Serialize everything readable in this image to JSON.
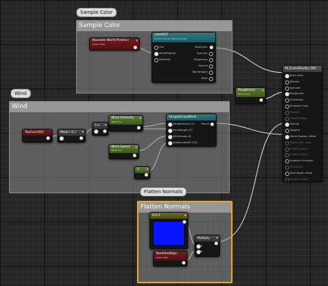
{
  "comments": {
    "sample_color": "Sample Color",
    "wind": "Wind",
    "flatten_normals": "Flatten Normals"
  },
  "nodes": {
    "absolute_world_position": {
      "title": "Absolute World Position",
      "sub": "Shader Data"
    },
    "color_rvt": {
      "title": "colorRVT",
      "sub": "Runtime Virtual Texture Sample",
      "inputs": [
        "UVs",
        "WorldPosition",
        "MipValue"
      ],
      "outputs": [
        "BaseColor",
        "Specular",
        "Roughness",
        "Normal",
        "WorldHeight",
        "Mask"
      ]
    },
    "roughness": {
      "title": "Roughness",
      "sub": "Param (0.4)"
    },
    "texcoord": {
      "title": "TexCoord[0]"
    },
    "mask_g": {
      "title": "Mask ( G )"
    },
    "one_minus": {
      "title": "1-x"
    },
    "wind_intensity": {
      "title": "Wind Intensity",
      "sub": "Param (1)"
    },
    "wind_speed": {
      "title": "Wind Speed",
      "sub": "Param (1)"
    },
    "zero_const": {
      "title": "0"
    },
    "simple_grass_wind": {
      "title": "SimpleGrassWind",
      "inputs": [
        "WindIntensity (S)",
        "WindWeight (S)",
        "WindSpeed (S)",
        "AdditionalWPO (V3)"
      ],
      "outputs": [
        "Result"
      ]
    },
    "vec_001": {
      "title": "0,0,1"
    },
    "multiply": {
      "title": "Multiply",
      "inputs": [
        "A",
        "B"
      ]
    },
    "two_sided_sign": {
      "title": "TwoSidedSign",
      "sub": "Vertex Data"
    },
    "material_result": {
      "title": "M_GrassShader_RM",
      "pins": [
        {
          "label": "Base Color",
          "active": true
        },
        {
          "label": "Metallic",
          "active": true
        },
        {
          "label": "Specular",
          "active": true
        },
        {
          "label": "Roughness",
          "active": true
        },
        {
          "label": "Anisotropy",
          "active": true
        },
        {
          "label": "Emissive Color",
          "active": true
        },
        {
          "label": "Opacity",
          "active": false
        },
        {
          "label": "Opacity Mask",
          "active": false
        },
        {
          "label": "Normal",
          "active": true
        },
        {
          "label": "Tangent",
          "active": true
        },
        {
          "label": "World Position Offset",
          "active": true
        },
        {
          "label": "Subsurface Color",
          "active": false
        },
        {
          "label": "Custom Data 0",
          "active": false
        },
        {
          "label": "Custom Data 1",
          "active": false
        },
        {
          "label": "Ambient Occlusion",
          "active": true
        },
        {
          "label": "Refraction",
          "active": false
        },
        {
          "label": "Pixel Depth Offset",
          "active": true
        },
        {
          "label": "Shading Model",
          "active": false
        }
      ]
    }
  },
  "colors": {
    "canvas": "#262626",
    "comment_fill": "#8c8c8c",
    "selected_outline": "#f0a81e",
    "header_red": "#7a1a1d",
    "header_green": "#5c7d2e",
    "header_teal": "#2d7b84",
    "preview_blue": "#0a14ff"
  }
}
